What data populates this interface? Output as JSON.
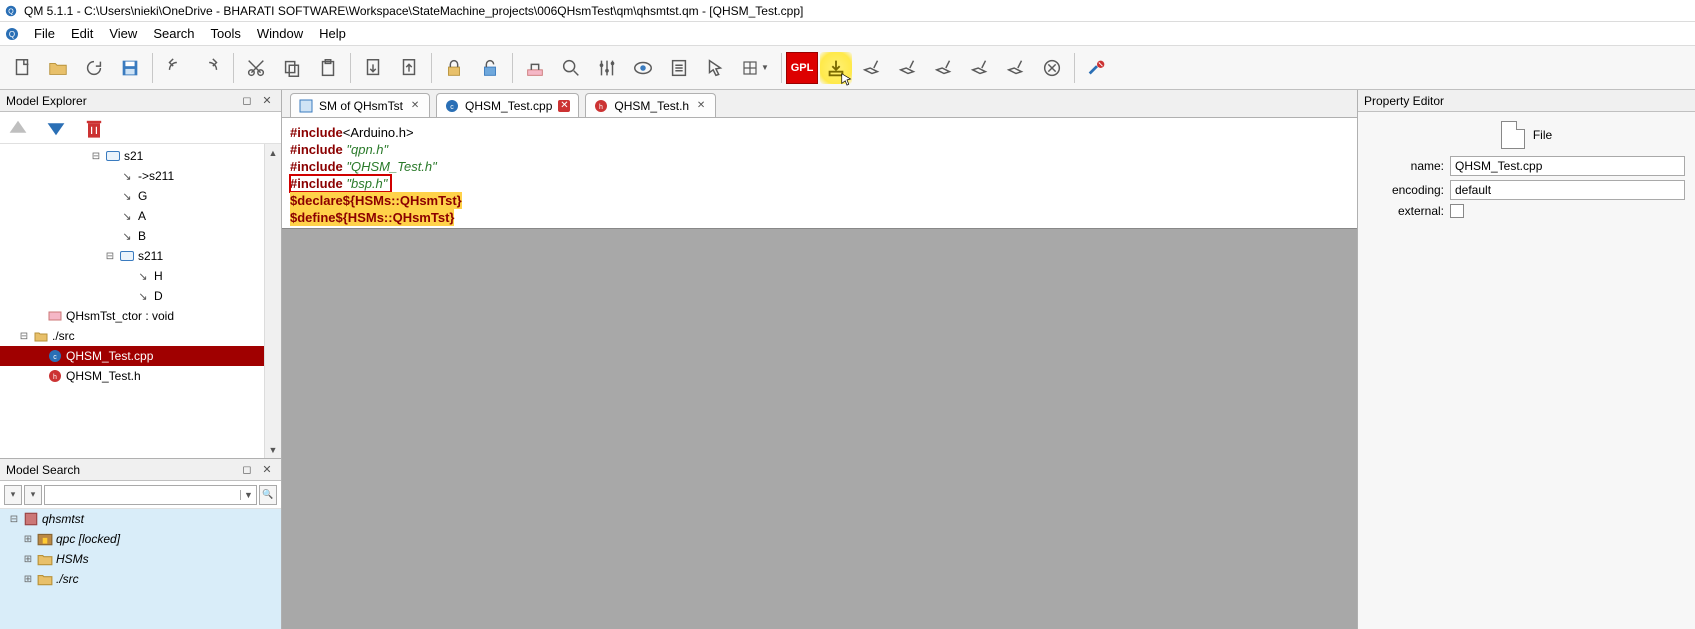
{
  "title": "QM 5.1.1 - C:\\Users\\nieki\\OneDrive - BHARATI SOFTWARE\\Workspace\\StateMachine_projects\\006QHsmTest\\qm\\qhsmtst.qm - [QHSM_Test.cpp]",
  "menu": {
    "file": "File",
    "edit": "Edit",
    "view": "View",
    "search": "Search",
    "tools": "Tools",
    "window": "Window",
    "help": "Help"
  },
  "toolbar": {
    "gpl": "GPL"
  },
  "explorer": {
    "title": "Model Explorer",
    "tree": {
      "s21": "s21",
      "to_s211": "->s211",
      "G": "G",
      "A": "A",
      "B": "B",
      "s211": "s211",
      "H": "H",
      "D": "D",
      "ctor": "QHsmTst_ctor : void",
      "src": "./src",
      "cpp": "QHSM_Test.cpp",
      "h": "QHSM_Test.h"
    }
  },
  "search": {
    "title": "Model Search",
    "results": {
      "root": "qhsmtst",
      "qpc": "qpc [locked]",
      "hsms": "HSMs",
      "src": "./src"
    }
  },
  "tabs": {
    "t1": "SM of QHsmTst",
    "t2": "QHSM_Test.cpp",
    "t3": "QHSM_Test.h"
  },
  "code": {
    "kw": "#include",
    "l1": "<Arduino.h>",
    "l2": "\"qpn.h\"",
    "l3": "\"QHSM_Test.h\"",
    "l4": "\"bsp.h\"",
    "l5": "$declare${HSMs::QHsmTst}",
    "l6": "$define${HSMs::QHsmTst}"
  },
  "props": {
    "title": "Property Editor",
    "type": "File",
    "name_lbl": "name:",
    "name_val": "QHSM_Test.cpp",
    "enc_lbl": "encoding:",
    "enc_val": "default",
    "ext_lbl": "external:"
  }
}
